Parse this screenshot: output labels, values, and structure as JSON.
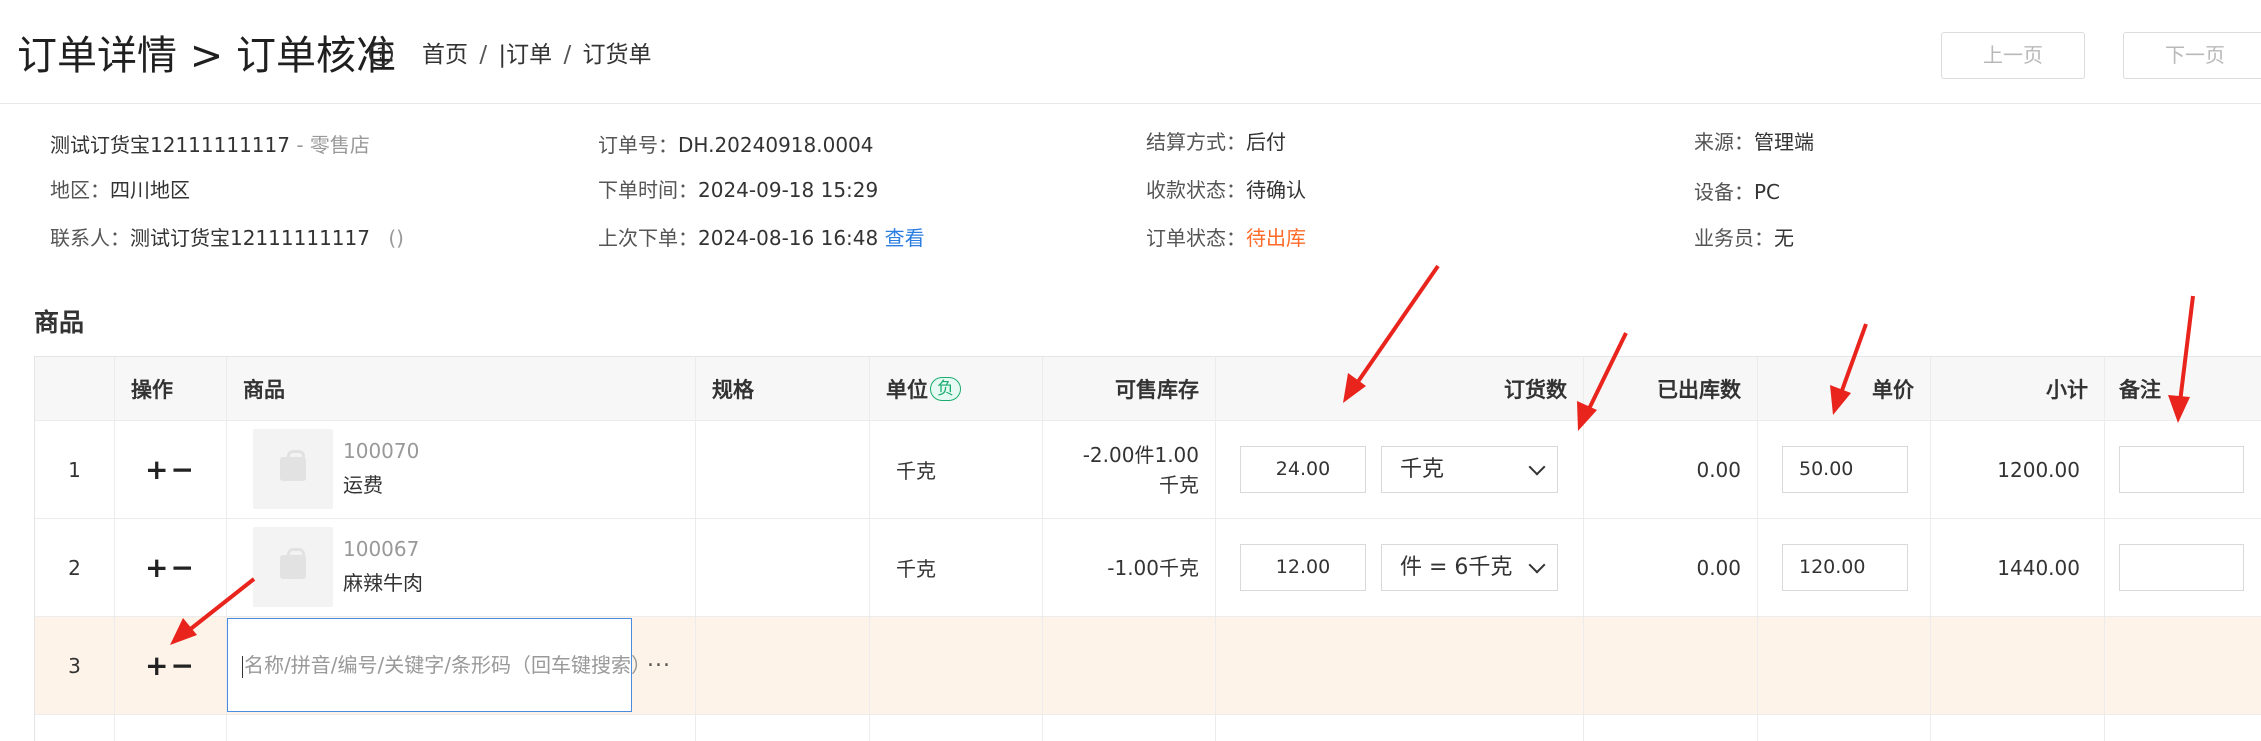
{
  "header": {
    "title": "订单详情 > 订单核准",
    "help_icon_glyph": "?",
    "breadcrumb": [
      "首页",
      "|订单",
      "订货单"
    ],
    "breadcrumb_sep": "/",
    "prev_page": "上一页",
    "next_page": "下一页"
  },
  "order": {
    "customer": "测试订货宝12111111117",
    "customer_type": " - 零售店",
    "region_label": "地区：",
    "region": "四川地区",
    "contact_label": "联系人：",
    "contact": "测试订货宝12111111117",
    "contact_phone": "()",
    "order_no_label": "订单号：",
    "order_no": "DH.20240918.0004",
    "order_time_label": "下单时间：",
    "order_time": "2024-09-18 15:29",
    "last_order_label": "上次下单：",
    "last_order_time": "2024-08-16 16:48",
    "view_link": "查看",
    "settlement_label": "结算方式：",
    "settlement": "后付",
    "payment_status_label": "收款状态：",
    "payment_status": "待确认",
    "order_status_label": "订单状态：",
    "order_status": "待出库",
    "source_label": "来源：",
    "source": "管理端",
    "device_label": "设备：",
    "device": "PC",
    "salesman_label": "业务员：",
    "salesman": "无"
  },
  "products": {
    "section_title": "商品",
    "columns": {
      "op": "操作",
      "product": "商品",
      "spec": "规格",
      "unit": "单位",
      "unit_badge": "负",
      "stock": "可售库存",
      "order_qty": "订货数",
      "shipped": "已出库数",
      "price": "单价",
      "subtotal": "小计",
      "remark": "备注"
    },
    "op_symbols": "+−",
    "rows": [
      {
        "index": "1",
        "code": "100070",
        "name": "运费",
        "spec": "",
        "unit": "千克",
        "stock_line1": "-2.00件1.00",
        "stock_line2": "千克",
        "qty": "24.00",
        "qty_unit": "千克",
        "shipped": "0.00",
        "price": "50.00",
        "subtotal": "1200.00",
        "remark": ""
      },
      {
        "index": "2",
        "code": "100067",
        "name": "麻辣牛肉",
        "spec": "",
        "unit": "千克",
        "stock_line1": "-1.00千克",
        "stock_line2": "",
        "qty": "12.00",
        "qty_unit": "件 = 6千克",
        "shipped": "0.00",
        "price": "120.00",
        "subtotal": "1440.00",
        "remark": ""
      }
    ],
    "new_row": {
      "index": "3",
      "search_placeholder": "名称/拼音/编号/关键字/条形码（回车键搜索）",
      "more": "..."
    }
  },
  "colors": {
    "accent_link": "#2b7de0",
    "status_orange": "#ff6a29",
    "badge_green": "#1aad6f",
    "annotation_arrow": "#e8241c",
    "new_row_bg": "#fdf3e9"
  }
}
